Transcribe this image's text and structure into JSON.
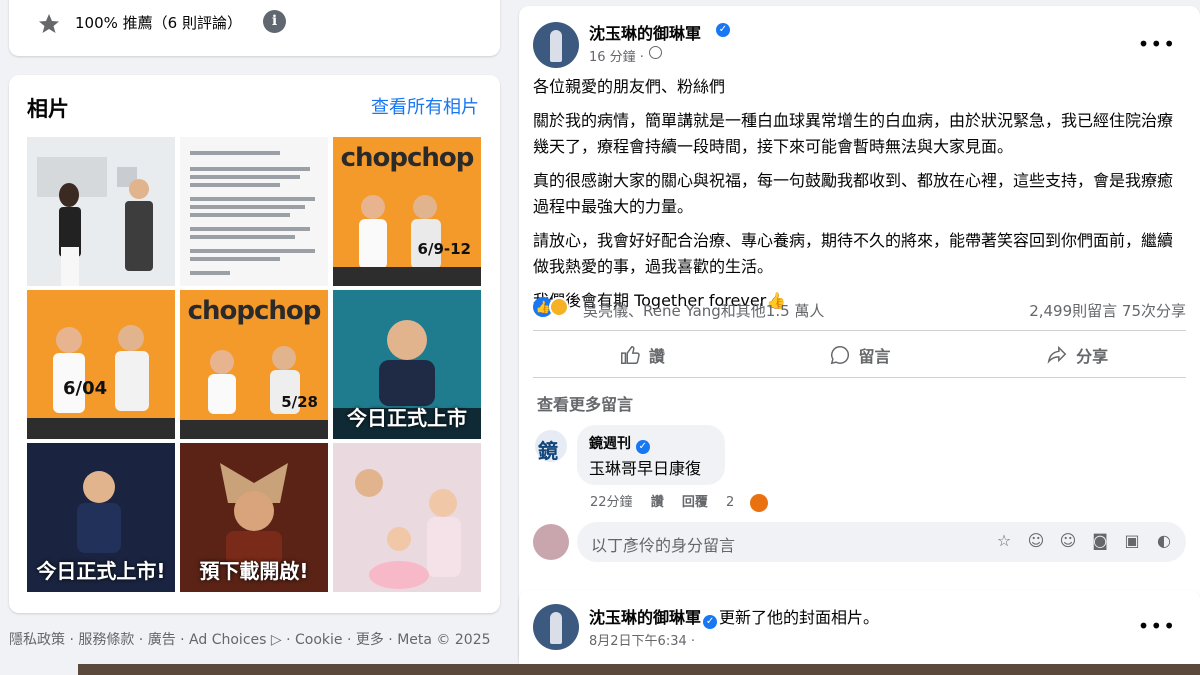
{
  "recommend": {
    "text": "100% 推薦（6 則評論）",
    "info": "i"
  },
  "photos": {
    "title": "相片",
    "see_all": "查看所有相片",
    "tiles": [
      {
        "style": "white",
        "big": "",
        "sub": "",
        "date": ""
      },
      {
        "style": "white",
        "big": "",
        "sub": "",
        "date": ""
      },
      {
        "style": "orange",
        "big": "chopchop",
        "sub": "",
        "date": "6/9-12"
      },
      {
        "style": "orange",
        "big": "",
        "sub": "",
        "date": "6/04"
      },
      {
        "style": "orange",
        "big": "chopchop",
        "sub": "",
        "date": "5/28"
      },
      {
        "style": "teal",
        "big": "",
        "sub": "今日正式上市",
        "date": ""
      },
      {
        "style": "dark",
        "big": "",
        "sub": "今日正式上市!",
        "date": ""
      },
      {
        "style": "red",
        "big": "",
        "sub": "預下載開啟!",
        "date": ""
      },
      {
        "style": "pink",
        "big": "",
        "sub": "",
        "date": ""
      }
    ]
  },
  "footer": {
    "text": "隱私政策 · 服務條款 · 廣告 · Ad Choices ▷ · Cookie · 更多 · Meta © 2025"
  },
  "post": {
    "author": "沈玉琳的御琳軍",
    "time": "16 分鐘 ·",
    "more": "•••",
    "paragraphs": [
      "各位親愛的朋友們、粉絲們",
      "關於我的病情，簡單講就是一種白血球異常增生的白血病，由於狀況緊急，我已經住院治療幾天了，療程會持續一段時間，接下來可能會暫時無法與大家見面。",
      "真的很感謝大家的關心與祝福，每一句鼓勵我都收到、都放在心裡，這些支持，會是我療癒過程中最強大的力量。",
      "請放心，我會好好配合治療、專心養病，期待不久的將來，能帶著笑容回到你們面前，繼續做我熱愛的事，過我喜歡的生活。",
      "我們後會有期  Together forever👍"
    ],
    "reacters": "吳亮儀、Rene Yang和其他1.5 萬人",
    "counts": "2,499則留言   75次分享",
    "actions": {
      "like": "讚",
      "comment": "留言",
      "share": "分享"
    },
    "more_comments": "查看更多留言",
    "comment": {
      "author": "鏡週刊",
      "text": "玉琳哥早日康復",
      "time": "22分鐘",
      "like": "讚",
      "reply": "回覆",
      "reaction_count": "2"
    },
    "comment_placeholder": "以丁彥伶的身分留言"
  },
  "post2": {
    "author": "沈玉琳的御琳軍",
    "action": "更新了他的封面相片。",
    "time": "8月2日下午6:34 ·",
    "more": "•••"
  },
  "colors": {
    "accent": "#1877f2",
    "muted": "#65676b",
    "bg": "#f0f2f5"
  }
}
